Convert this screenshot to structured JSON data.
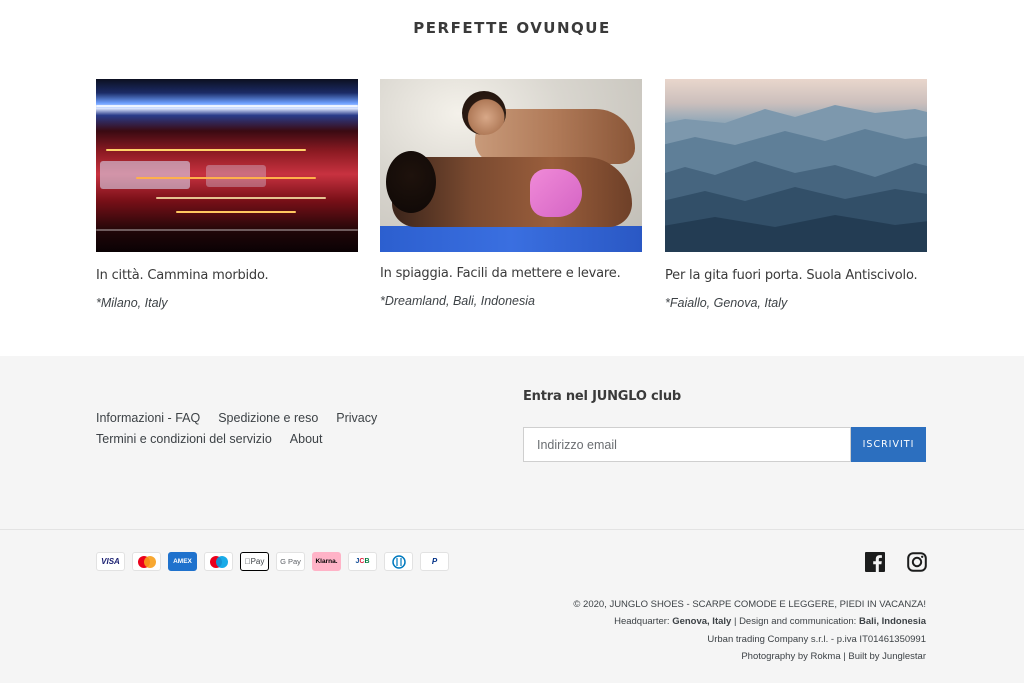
{
  "section_title": "PERFETTE OVUNQUE",
  "cards": [
    {
      "caption": "In città. Cammina morbido.",
      "location": "*Milano, Italy"
    },
    {
      "caption": "In spiaggia. Facili da mettere e levare.",
      "location": "*Dreamland, Bali, Indonesia"
    },
    {
      "caption": "Per la gita fuori porta. Suola Antiscivolo.",
      "location": "*Faiallo, Genova, Italy"
    }
  ],
  "footer": {
    "links": [
      "Informazioni - FAQ",
      "Spedizione e reso",
      "Privacy",
      "Termini e condizioni del servizio",
      "About"
    ],
    "newsletter": {
      "title": "Entra nel JUNGLO club",
      "placeholder": "Indirizzo email",
      "button": "ISCRIVITI"
    },
    "payments": [
      "VISA",
      "Mastercard",
      "AMEX",
      "Maestro",
      "Apple Pay",
      "G Pay",
      "Klarna.",
      "JCB",
      "Diners",
      "PayPal"
    ],
    "payment_text": {
      "visa": "VISA",
      "amex": "AMEX",
      "apple": "Pay",
      "gpay": "G Pay",
      "klarna": "Klarna.",
      "jcb": "JCB",
      "paypal": "P"
    },
    "social": [
      "facebook-icon",
      "instagram-icon"
    ],
    "legal": {
      "copyright": "© 2020, JUNGLO SHOES - SCARPE COMODE E LEGGERE, PIEDI IN VACANZA!",
      "hq_label": "Headquarter: ",
      "hq_value": "Genova, Italy",
      "sep1": " | Design and communication: ",
      "design_value": "Bali, Indonesia",
      "company": "Urban trading Company s.r.l. - p.iva IT01461350991",
      "credits": "Photography by Rokma | Built by Junglestar"
    },
    "colors": {
      "accent": "#2c6fbf",
      "footer_bg": "#f5f5f5",
      "klarna": "#ffb3c7"
    }
  }
}
